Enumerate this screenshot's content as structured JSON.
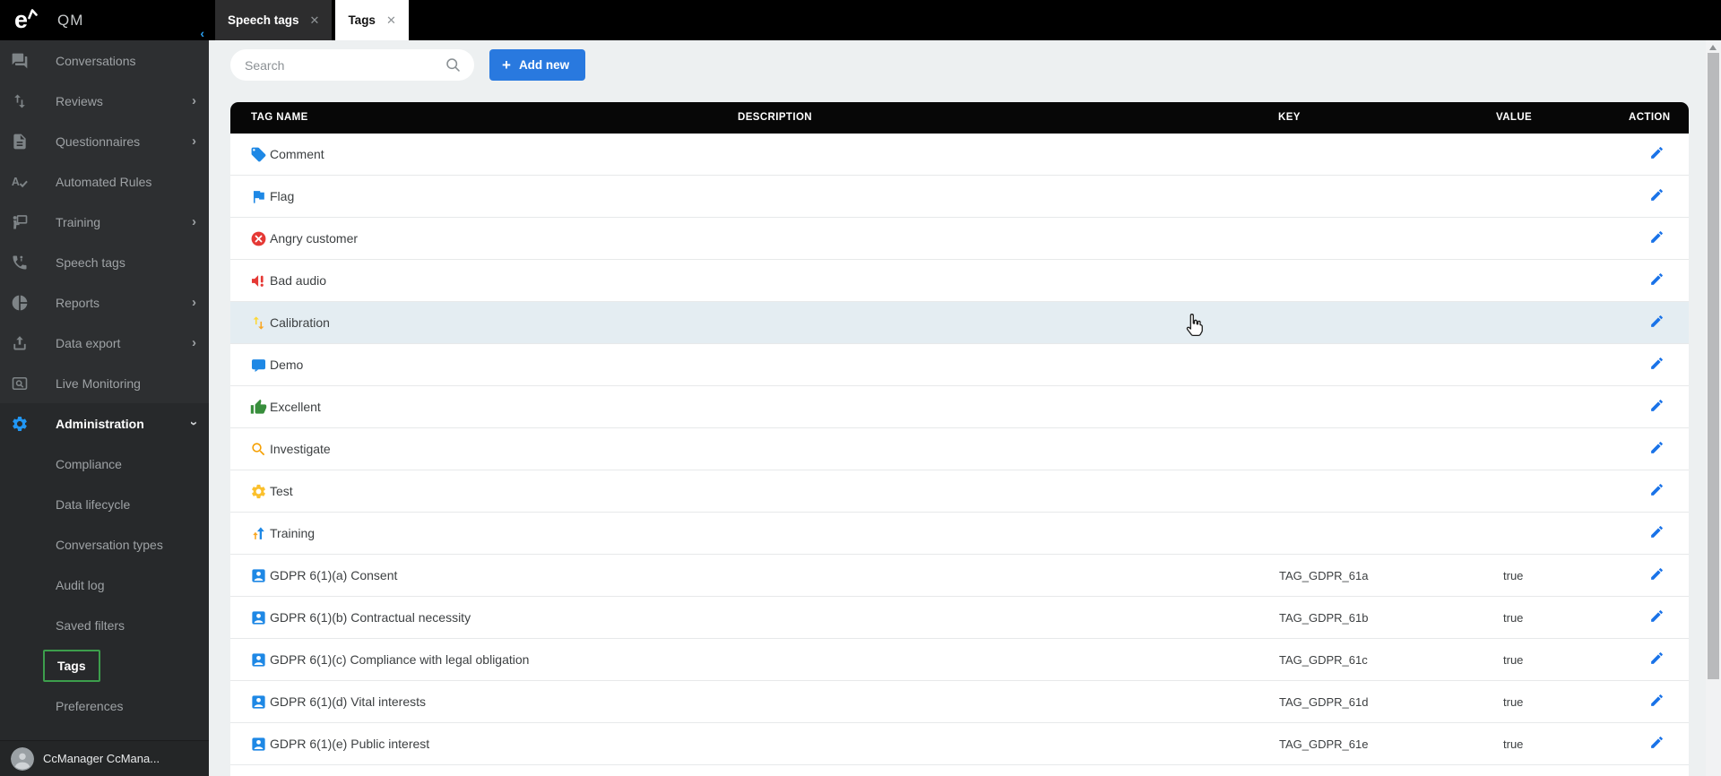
{
  "app": {
    "logo_letter": "e",
    "title": "QM"
  },
  "tabs": [
    {
      "label": "Speech tags",
      "active": false
    },
    {
      "label": "Tags",
      "active": true
    }
  ],
  "toolbar": {
    "search_placeholder": "Search",
    "add_new_label": "Add new",
    "add_new_plus": "+"
  },
  "sidebar": {
    "items": [
      {
        "label": "Conversations",
        "icon": "conversations-icon",
        "chevron": ""
      },
      {
        "label": "Reviews",
        "icon": "reviews-icon",
        "chevron": "right"
      },
      {
        "label": "Questionnaires",
        "icon": "questionnaires-icon",
        "chevron": "right"
      },
      {
        "label": "Automated Rules",
        "icon": "automated-rules-icon",
        "chevron": ""
      },
      {
        "label": "Training",
        "icon": "training-icon",
        "chevron": "right"
      },
      {
        "label": "Speech tags",
        "icon": "speech-tags-icon",
        "chevron": ""
      },
      {
        "label": "Reports",
        "icon": "reports-icon",
        "chevron": "right"
      },
      {
        "label": "Data export",
        "icon": "data-export-icon",
        "chevron": "right"
      },
      {
        "label": "Live Monitoring",
        "icon": "live-monitoring-icon",
        "chevron": ""
      }
    ],
    "admin": {
      "label": "Administration",
      "icon": "gear-icon",
      "chevron": "down",
      "subitems": [
        {
          "label": "Compliance",
          "selected": false
        },
        {
          "label": "Data lifecycle",
          "selected": false
        },
        {
          "label": "Conversation types",
          "selected": false
        },
        {
          "label": "Audit log",
          "selected": false
        },
        {
          "label": "Saved filters",
          "selected": false
        },
        {
          "label": "Tags",
          "selected": true
        },
        {
          "label": "Preferences",
          "selected": false
        }
      ]
    },
    "user": {
      "name": "CcManager CcMana..."
    }
  },
  "table": {
    "columns": [
      "TAG NAME",
      "DESCRIPTION",
      "KEY",
      "VALUE",
      "ACTION"
    ],
    "rows": [
      {
        "name": "Comment",
        "icon": "tag-icon",
        "description": "",
        "key": "",
        "value": "",
        "hovered": false
      },
      {
        "name": "Flag",
        "icon": "flag-icon",
        "description": "",
        "key": "",
        "value": "",
        "hovered": false
      },
      {
        "name": "Angry customer",
        "icon": "angry-customer-icon",
        "description": "",
        "key": "",
        "value": "",
        "hovered": false
      },
      {
        "name": "Bad audio",
        "icon": "bad-audio-icon",
        "description": "",
        "key": "",
        "value": "",
        "hovered": false
      },
      {
        "name": "Calibration",
        "icon": "calibration-icon",
        "description": "",
        "key": "",
        "value": "",
        "hovered": true
      },
      {
        "name": "Demo",
        "icon": "demo-icon",
        "description": "",
        "key": "",
        "value": "",
        "hovered": false
      },
      {
        "name": "Excellent",
        "icon": "thumbs-up-icon",
        "description": "",
        "key": "",
        "value": "",
        "hovered": false
      },
      {
        "name": "Investigate",
        "icon": "magnifier-orange-icon",
        "description": "",
        "key": "",
        "value": "",
        "hovered": false
      },
      {
        "name": "Test",
        "icon": "gear-amber-icon",
        "description": "",
        "key": "",
        "value": "",
        "hovered": false
      },
      {
        "name": "Training",
        "icon": "arrows-up-icon",
        "description": "",
        "key": "",
        "value": "",
        "hovered": false
      },
      {
        "name": "GDPR 6(1)(a) Consent",
        "icon": "account-icon",
        "description": "",
        "key": "TAG_GDPR_61a",
        "value": "true",
        "hovered": false
      },
      {
        "name": "GDPR 6(1)(b) Contractual necessity",
        "icon": "account-icon",
        "description": "",
        "key": "TAG_GDPR_61b",
        "value": "true",
        "hovered": false
      },
      {
        "name": "GDPR 6(1)(c) Compliance with legal obligation",
        "icon": "account-icon",
        "description": "",
        "key": "TAG_GDPR_61c",
        "value": "true",
        "hovered": false
      },
      {
        "name": "GDPR 6(1)(d) Vital interests",
        "icon": "account-icon",
        "description": "",
        "key": "TAG_GDPR_61d",
        "value": "true",
        "hovered": false
      },
      {
        "name": "GDPR 6(1)(e) Public interest",
        "icon": "account-icon",
        "description": "",
        "key": "TAG_GDPR_61e",
        "value": "true",
        "hovered": false
      }
    ]
  },
  "colors": {
    "accent_blue": "#2979df",
    "icon_blue": "#1e88e5",
    "selection_green": "#3c9e4c",
    "danger_red": "#e53935",
    "success_green": "#388e3c",
    "warning_amber": "#f9a825",
    "header_black": "#070707",
    "row_hover": "#e4edf2"
  }
}
